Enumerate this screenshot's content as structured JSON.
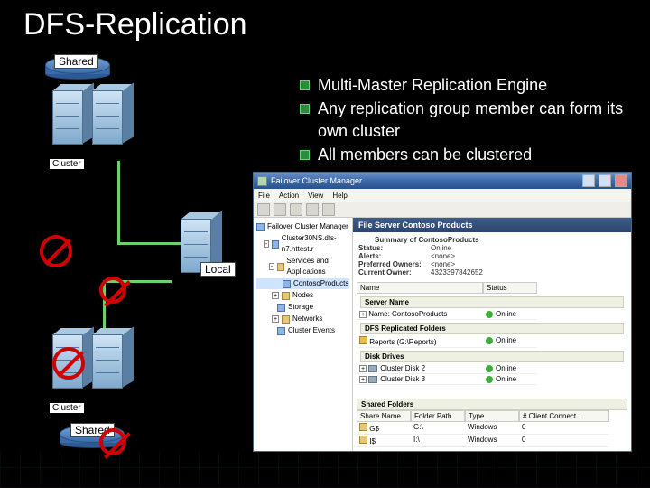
{
  "title": "DFS-Replication",
  "bullets": [
    "Multi-Master Replication Engine",
    "Any replication group member can form its own cluster",
    "All members can be clustered"
  ],
  "labels": {
    "shared_top": "Shared",
    "cluster_top": "Cluster",
    "local": "Local",
    "cluster_bottom": "Cluster",
    "shared_bottom": "Shared"
  },
  "window": {
    "title": "Failover Cluster Manager",
    "menu": [
      "File",
      "Action",
      "View",
      "Help"
    ],
    "tree": {
      "root": "Failover Cluster Manager",
      "cluster": "Cluster30NS.dfs-n7.nttest.r",
      "s_and_a": "Services and Applications",
      "san_n0": "ContosoProducts",
      "nodes": "Nodes",
      "storage": "Storage",
      "networks": "Networks",
      "events": "Cluster Events"
    },
    "content": {
      "header": "File Server Contoso Products",
      "summary_label": "Summary of ContosoProducts",
      "status_label": "Status:",
      "status_value": "Online",
      "alerts_label": "Alerts:",
      "alerts_value": "<none>",
      "owner_label": "Preferred Owners:",
      "owner_value": "<none>",
      "current_label": "Current Owner:",
      "current_value": "4323397842652",
      "table_hdr_name": "Name",
      "table_hdr_status": "Status",
      "table_hdr_share": "Share Name",
      "table_hdr_path": "Folder Path",
      "table_hdr_type": "Type",
      "table_hdr_clients": "# Client Connect...",
      "band_server": "Server Name",
      "row_srv_name": "Name: ContosoProducts",
      "row_srv_status": "Online",
      "band_dfs": "DFS Replicated Folders",
      "row_dfs_name": "Reports (G:\\Reports)",
      "row_dfs_status": "Online",
      "band_disks": "Disk Drives",
      "row_d1": "Cluster Disk 2",
      "row_d1_status": "Online",
      "row_d2": "Cluster Disk 3",
      "row_d2_status": "Online",
      "band_shared": "Shared Folders",
      "sf_rows": [
        {
          "name": "G$",
          "path": "G:\\",
          "type": "Windows",
          "clients": "0"
        },
        {
          "name": "I$",
          "path": "I:\\",
          "type": "Windows",
          "clients": "0"
        }
      ]
    }
  }
}
